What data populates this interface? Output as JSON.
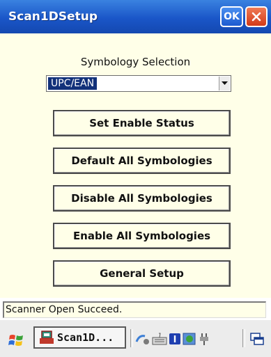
{
  "window": {
    "title": "Scan1DSetup",
    "ok_label": "OK"
  },
  "symbology": {
    "label": "Symbology Selection",
    "selected": "UPC/EAN"
  },
  "buttons": {
    "set_enable_status": "Set Enable Status",
    "default_all": "Default All Symbologies",
    "disable_all": "Disable All Symbologies",
    "enable_all": "Enable All Symbologies",
    "general_setup": "General Setup"
  },
  "status": {
    "text": "Scanner Open Succeed."
  },
  "taskbar": {
    "start_icon": "windows-flag-icon",
    "task_label": "Scan1D...",
    "tray_icons": [
      "network-icon",
      "keyboard-icon",
      "bluetooth-icon",
      "globe-icon",
      "power-plug-icon",
      "desktop-icon"
    ]
  },
  "colors": {
    "titlebar": "#1a56c8",
    "close": "#d23a18",
    "background": "#ffffe8",
    "selection": "#12317a"
  }
}
